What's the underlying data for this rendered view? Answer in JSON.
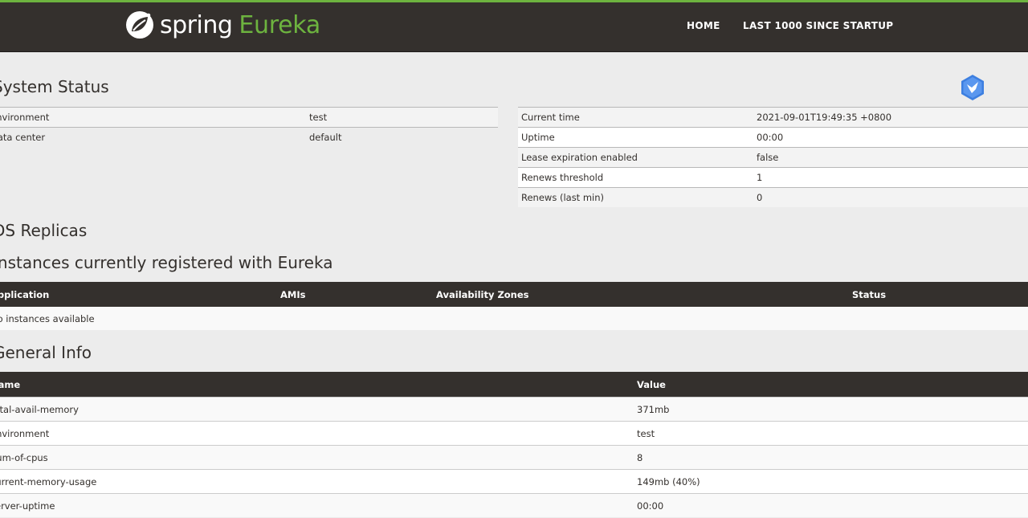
{
  "colors": {
    "accent": "#6db33f",
    "nav_bg": "#34302d",
    "page_bg": "#ececec"
  },
  "brand": {
    "spring": "spring",
    "eureka": "Eureka",
    "icon": "spring-leaf-icon"
  },
  "nav": {
    "home": "HOME",
    "last": "LAST 1000 SINCE STARTUP"
  },
  "headings": {
    "system_status": "System Status",
    "replicas": "DS Replicas",
    "instances": "Instances currently registered with Eureka",
    "general_info": "General Info"
  },
  "status_left": [
    {
      "key": "Environment",
      "value": "test"
    },
    {
      "key": "Data center",
      "value": "default"
    }
  ],
  "status_right": [
    {
      "key": "Current time",
      "value": "2021-09-01T19:49:35 +0800"
    },
    {
      "key": "Uptime",
      "value": "00:00"
    },
    {
      "key": "Lease expiration enabled",
      "value": "false"
    },
    {
      "key": "Renews threshold",
      "value": "1"
    },
    {
      "key": "Renews (last min)",
      "value": "0"
    }
  ],
  "instances": {
    "columns": [
      "Application",
      "AMIs",
      "Availability Zones",
      "Status"
    ],
    "empty": "No instances available"
  },
  "general": {
    "columns": [
      "Name",
      "Value"
    ],
    "rows": [
      {
        "name": "total-avail-memory",
        "value": "371mb"
      },
      {
        "name": "environment",
        "value": "test"
      },
      {
        "name": "num-of-cpus",
        "value": "8"
      },
      {
        "name": "current-memory-usage",
        "value": "149mb (40%)"
      },
      {
        "name": "server-uptime",
        "value": "00:00"
      }
    ]
  },
  "badge_icon": "bird-hexagon-icon"
}
